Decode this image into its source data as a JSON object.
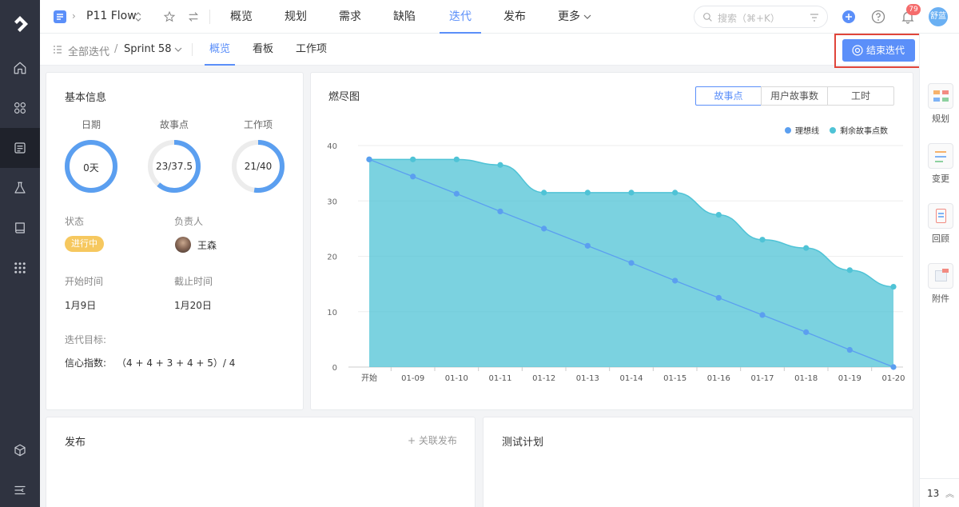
{
  "project": {
    "name": "P11 Flow"
  },
  "top_nav": [
    "概览",
    "规划",
    "需求",
    "缺陷",
    "迭代",
    "发布",
    "更多"
  ],
  "top_nav_active": "迭代",
  "search": {
    "placeholder": "搜索（⌘+K）"
  },
  "notifications": {
    "count": "79"
  },
  "user": {
    "avatar_text": "舒蓝"
  },
  "breadcrumb": {
    "root": "全部迭代",
    "current": "Sprint 58"
  },
  "sub_tabs": [
    "概览",
    "看板",
    "工作项"
  ],
  "end_button": "结束迭代",
  "basic_info": {
    "title": "基本信息",
    "rings": [
      {
        "label": "日期",
        "value": "0天",
        "fraction": 1.0,
        "track_color": "#5b9ff0"
      },
      {
        "label": "故事点",
        "value": "23/37.5",
        "fraction": 0.613
      },
      {
        "label": "工作项",
        "value": "21/40",
        "fraction": 0.525
      }
    ],
    "status_label": "状态",
    "status_value": "进行中",
    "owner_label": "负责人",
    "owner_name": "王森",
    "start_label": "开始时间",
    "start_value": "1月9日",
    "end_label": "截止时间",
    "end_value": "1月20日",
    "goal_label": "迭代目标:",
    "confidence_label": "信心指数:",
    "confidence_value": "（4 + 4 + 3 + 4 + 5）/ 4"
  },
  "burndown": {
    "title": "燃尽图",
    "segments": [
      "故事点",
      "用户故事数",
      "工时"
    ],
    "segment_active": "故事点"
  },
  "chart_data": {
    "type": "area",
    "categories": [
      "开始",
      "01-09",
      "01-10",
      "01-11",
      "01-12",
      "01-13",
      "01-14",
      "01-15",
      "01-16",
      "01-17",
      "01-18",
      "01-19",
      "01-20"
    ],
    "series": [
      {
        "name": "理想线",
        "type": "line",
        "color": "#5b9ff0",
        "values": [
          37.5,
          34.4,
          31.3,
          28.1,
          25.0,
          21.9,
          18.8,
          15.6,
          12.5,
          9.4,
          6.3,
          3.1,
          0
        ]
      },
      {
        "name": "剩余故事点数",
        "type": "area",
        "color": "#4fc3d6",
        "values": [
          37.5,
          37.5,
          37.5,
          36.5,
          31.5,
          31.5,
          31.5,
          31.5,
          27.5,
          23,
          21.5,
          17.5,
          14.5
        ]
      }
    ],
    "ylim": [
      0,
      40
    ],
    "yticks": [
      0,
      10,
      20,
      30,
      40
    ],
    "legend": "top-right",
    "grid": true
  },
  "release": {
    "title": "发布",
    "action": "关联发布"
  },
  "test_plan": {
    "title": "测试计划"
  },
  "right_panel": [
    "规划",
    "变更",
    "回顾",
    "附件"
  ],
  "page_counter": "13"
}
